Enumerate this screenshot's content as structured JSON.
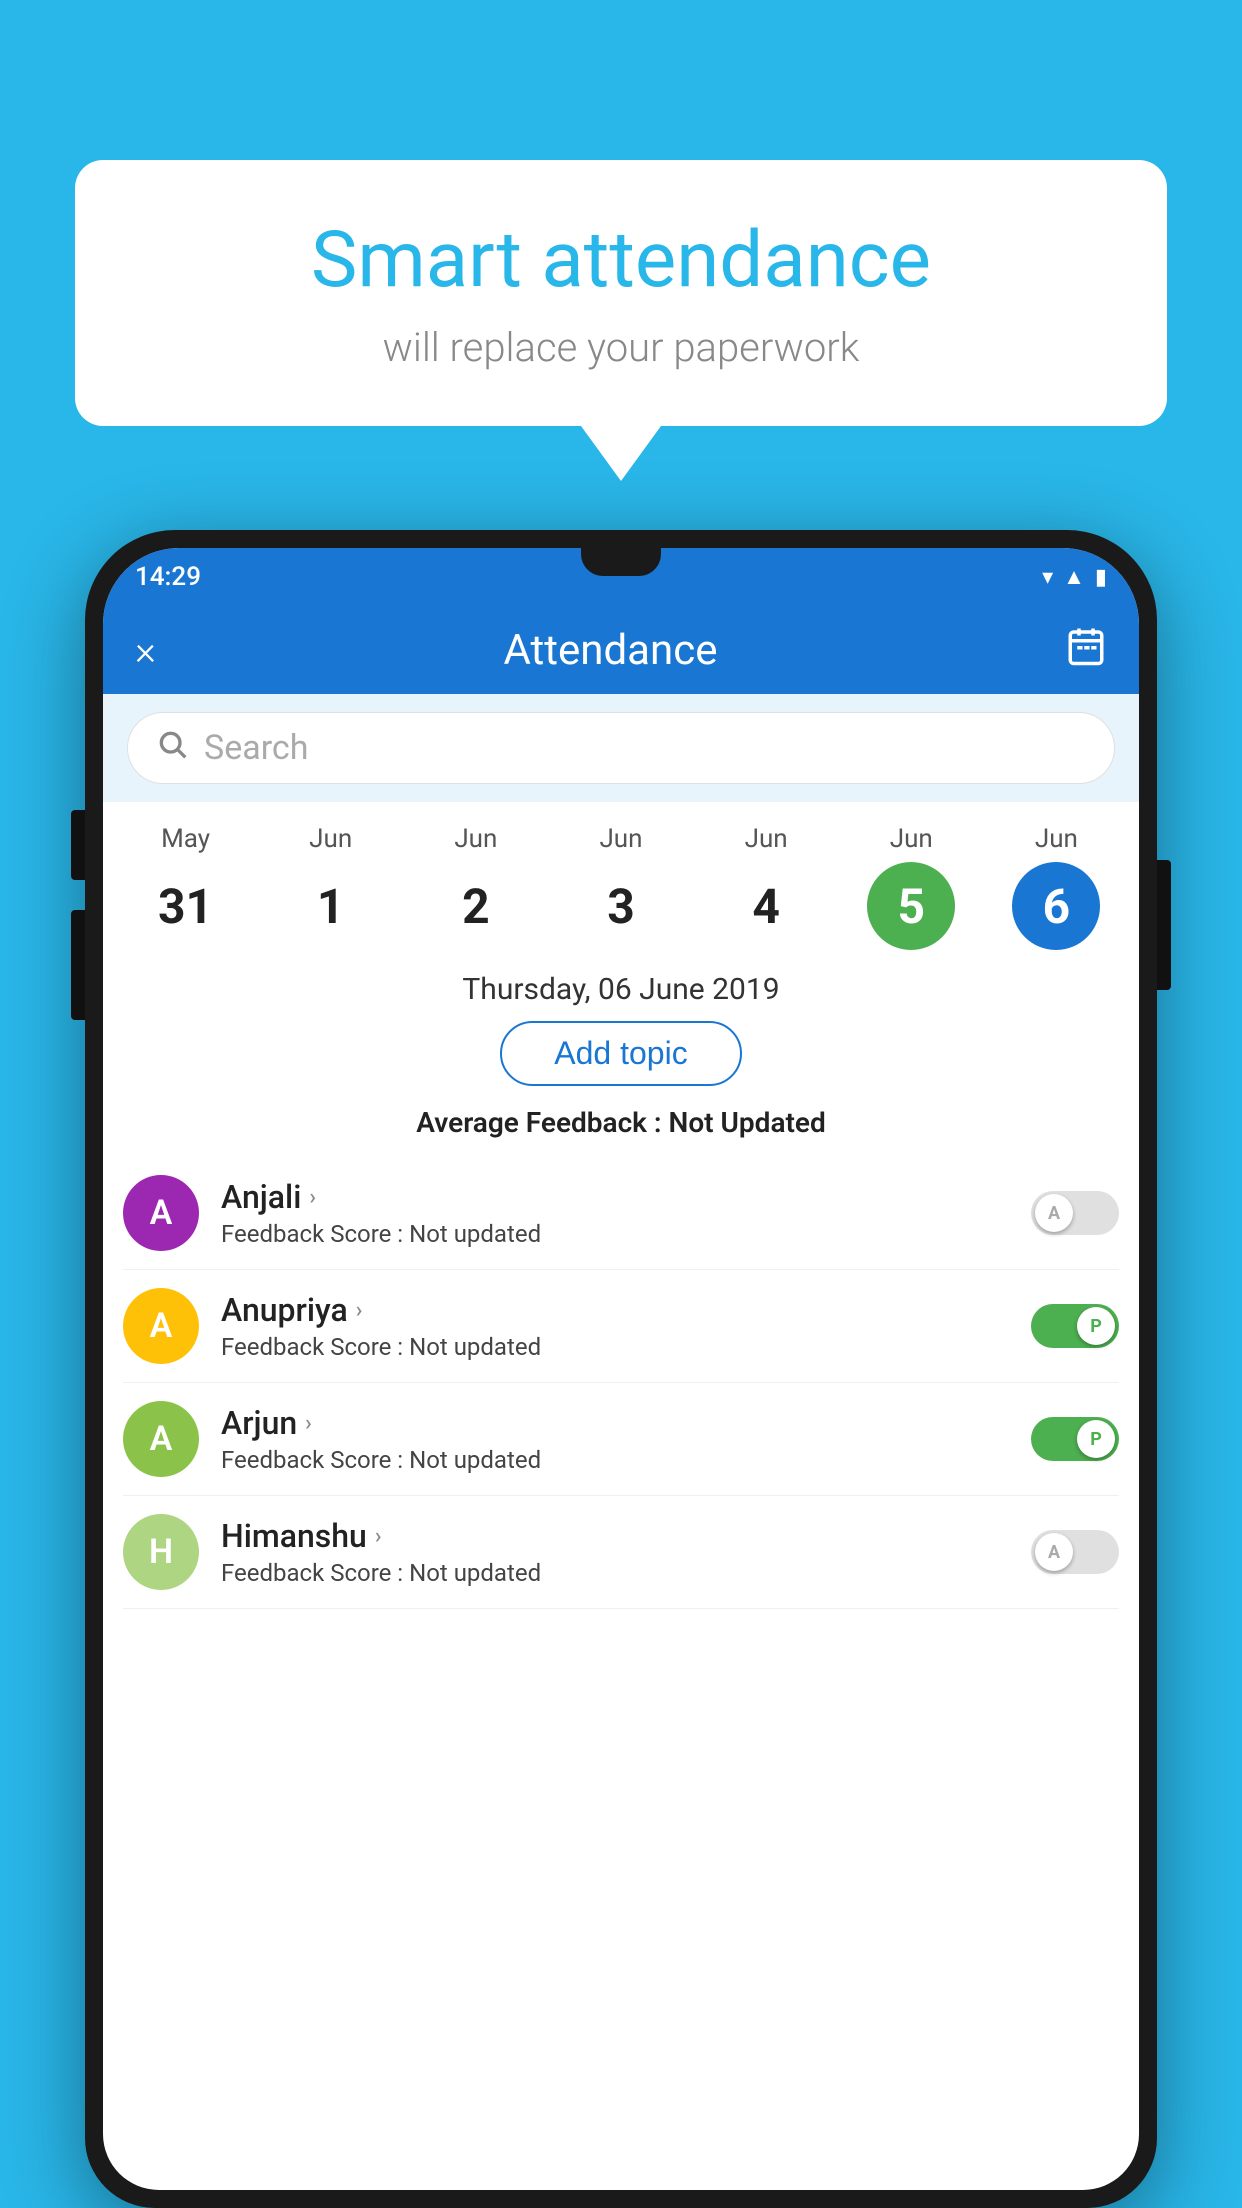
{
  "background_color": "#29b6e8",
  "bubble": {
    "title": "Smart attendance",
    "subtitle": "will replace your paperwork"
  },
  "status_bar": {
    "time": "14:29",
    "icons": [
      "wifi",
      "signal",
      "battery"
    ]
  },
  "header": {
    "title": "Attendance",
    "close_label": "×",
    "calendar_label": "📅"
  },
  "search": {
    "placeholder": "Search"
  },
  "calendar": {
    "days": [
      {
        "month": "May",
        "date": "31",
        "style": "normal"
      },
      {
        "month": "Jun",
        "date": "1",
        "style": "normal"
      },
      {
        "month": "Jun",
        "date": "2",
        "style": "normal"
      },
      {
        "month": "Jun",
        "date": "3",
        "style": "normal"
      },
      {
        "month": "Jun",
        "date": "4",
        "style": "normal"
      },
      {
        "month": "Jun",
        "date": "5",
        "style": "today"
      },
      {
        "month": "Jun",
        "date": "6",
        "style": "selected"
      }
    ]
  },
  "selected_date_label": "Thursday, 06 June 2019",
  "add_topic_label": "Add topic",
  "avg_feedback": {
    "label": "Average Feedback : ",
    "value": "Not Updated"
  },
  "students": [
    {
      "name": "Anjali",
      "avatar_letter": "A",
      "avatar_color": "#9c27b0",
      "feedback_label": "Feedback Score : ",
      "feedback_value": "Not updated",
      "toggle": "off",
      "toggle_letter": "A"
    },
    {
      "name": "Anupriya",
      "avatar_letter": "A",
      "avatar_color": "#ffc107",
      "feedback_label": "Feedback Score : ",
      "feedback_value": "Not updated",
      "toggle": "on",
      "toggle_letter": "P"
    },
    {
      "name": "Arjun",
      "avatar_letter": "A",
      "avatar_color": "#8bc34a",
      "feedback_label": "Feedback Score : ",
      "feedback_value": "Not updated",
      "toggle": "on",
      "toggle_letter": "P"
    },
    {
      "name": "Himanshu",
      "avatar_letter": "H",
      "avatar_color": "#aed581",
      "feedback_label": "Feedback Score : ",
      "feedback_value": "Not updated",
      "toggle": "off",
      "toggle_letter": "A"
    }
  ]
}
